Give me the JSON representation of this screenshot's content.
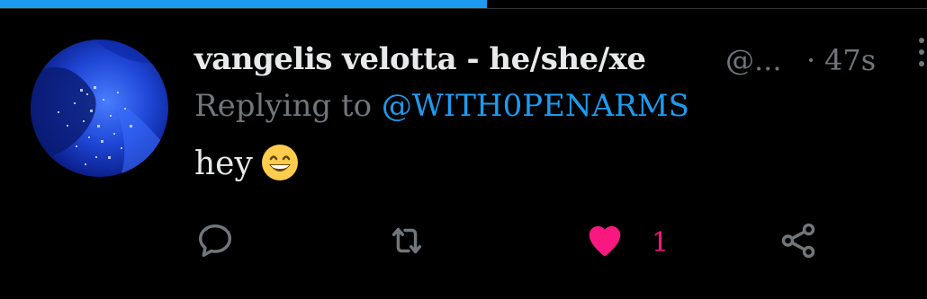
{
  "progress": {
    "fraction": 0.525,
    "color": "#1d9bf0"
  },
  "tweet": {
    "display_name": "vangelis velotta - he/she/xe",
    "handle": "@...",
    "separator": "·",
    "timestamp": "47s",
    "reply_prefix": "Replying to",
    "reply_target": "@WITH0PENARMS",
    "text": "hey",
    "emoji": "grinning-face-with-smiling-eyes"
  },
  "actions": {
    "reply_icon": "speech-bubble-icon",
    "retweet_icon": "retweet-icon",
    "like_icon": "heart-icon",
    "like_count": "1",
    "like_active": true,
    "share_icon": "share-icon"
  },
  "colors": {
    "background": "#000000",
    "text_primary": "#e7e9ea",
    "text_secondary": "#71767b",
    "accent": "#1d9bf0",
    "like": "#f91880"
  }
}
